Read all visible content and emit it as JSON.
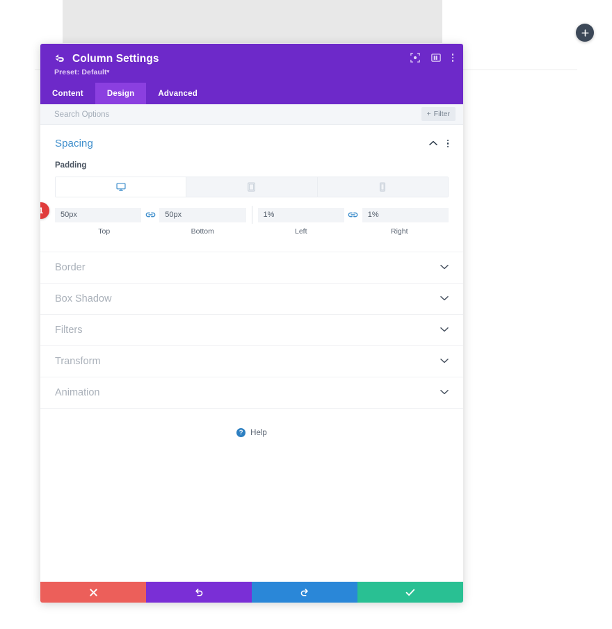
{
  "canvas": {
    "add_button_icon": "plus-icon",
    "add_button_label": "+"
  },
  "modal": {
    "back_icon": "back-arrow-icon",
    "title": "Column Settings",
    "preset_label": "Preset: Default",
    "preset_caret": "▾",
    "header_icons": [
      {
        "name": "focus-icon",
        "glyph": "focus"
      },
      {
        "name": "layout-panel-icon",
        "glyph": "panel"
      },
      {
        "name": "kebab-menu-icon",
        "glyph": "kebab"
      }
    ],
    "tabs": [
      {
        "label": "Content",
        "active": false
      },
      {
        "label": "Design",
        "active": true
      },
      {
        "label": "Advanced",
        "active": false
      }
    ],
    "search": {
      "placeholder": "Search Options",
      "filter_label": "Filter",
      "filter_plus": "+"
    },
    "spacing": {
      "title": "Spacing",
      "collapse_icon": "chevron-up-icon",
      "menu_icon": "kebab-menu-icon",
      "padding_label": "Padding",
      "devices": [
        {
          "name": "desktop",
          "icon": "desktop-icon",
          "active": true
        },
        {
          "name": "tablet",
          "icon": "tablet-icon",
          "active": false
        },
        {
          "name": "phone",
          "icon": "phone-icon",
          "active": false
        }
      ],
      "badge": "1",
      "fields": [
        {
          "value": "50px",
          "caption": "Top"
        },
        {
          "value": "50px",
          "caption": "Bottom"
        },
        {
          "value": "1%",
          "caption": "Left"
        },
        {
          "value": "1%",
          "caption": "Right"
        }
      ],
      "link_icon": "link-chain-icon"
    },
    "sections": [
      {
        "label": "Border"
      },
      {
        "label": "Box Shadow"
      },
      {
        "label": "Filters"
      },
      {
        "label": "Transform"
      },
      {
        "label": "Animation"
      }
    ],
    "help": {
      "label": "Help",
      "icon": "question-mark-icon",
      "glyph": "?"
    },
    "footer": [
      {
        "name": "cancel",
        "icon": "close-x-icon",
        "glyph": "✖",
        "color": "#ec5f5a"
      },
      {
        "name": "undo",
        "icon": "undo-icon",
        "glyph": "↺",
        "color": "#7a2fd6"
      },
      {
        "name": "redo",
        "icon": "redo-icon",
        "glyph": "↻",
        "color": "#2a87d8"
      },
      {
        "name": "save",
        "icon": "check-icon",
        "glyph": "✔",
        "color": "#29c093"
      }
    ]
  }
}
